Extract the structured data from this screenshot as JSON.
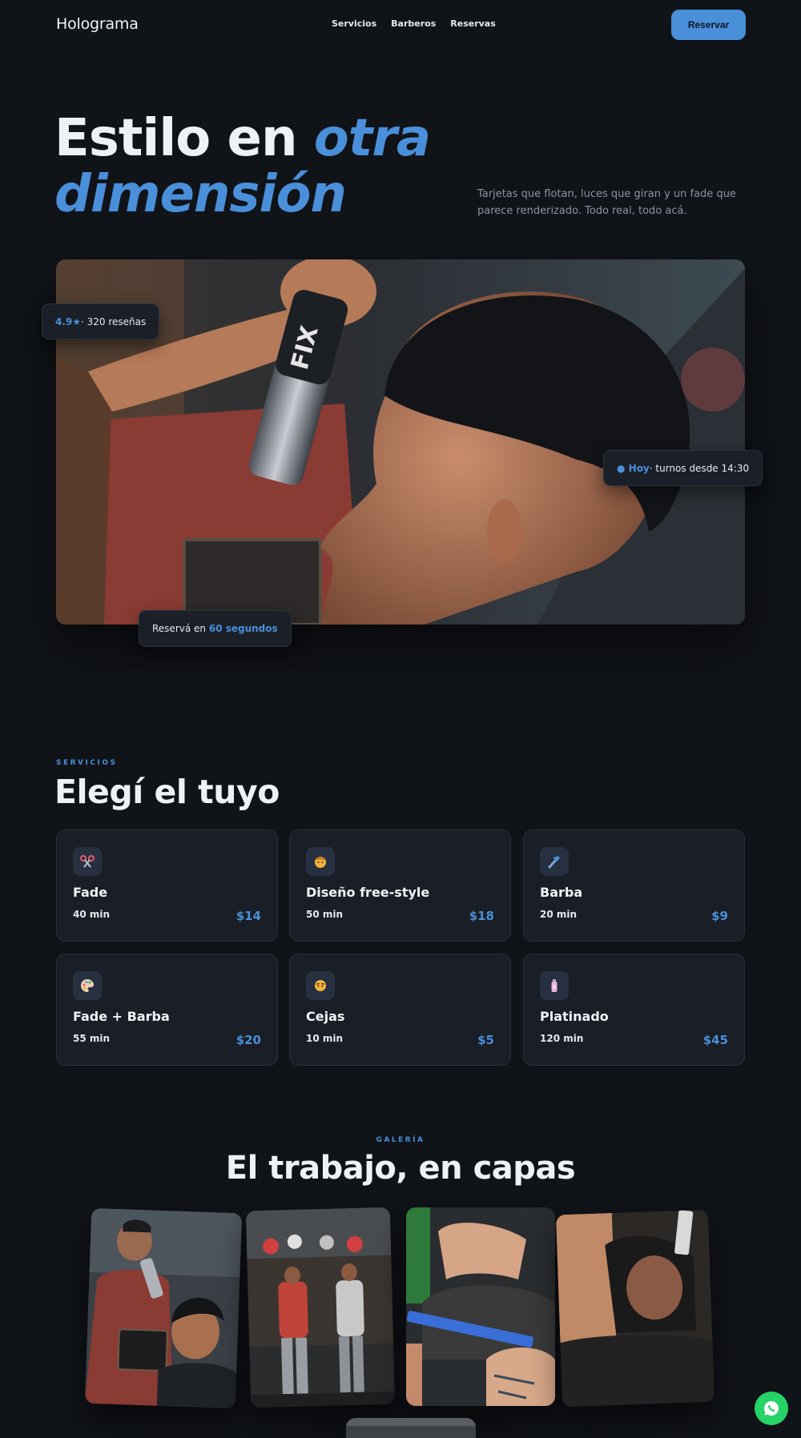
{
  "nav": {
    "brand": "Holograma",
    "links": [
      "Servicios",
      "Barberos",
      "Reservas"
    ],
    "cta": "Reservar"
  },
  "hero": {
    "title_line1": "Estilo en ",
    "title_em1": "otra",
    "title_em2": "dimensión",
    "subtitle": "Tarjetas que flotan, luces que giran y un fade que parece renderizado. Todo real, todo acá.",
    "chips": {
      "rating_value": "4.9★",
      "rating_text": " · 320 reseñas",
      "today_dot": "● Hoy",
      "today_text": " · turnos desde 14:30",
      "book_text": "Reservá en ",
      "book_em": "60 segundos"
    }
  },
  "services": {
    "eyebrow": "SERVICIOS",
    "title": "Elegí el tuyo",
    "items": [
      {
        "icon": "scissors-icon",
        "name": "Fade",
        "duration": "40 min",
        "price": "$14"
      },
      {
        "icon": "man-face-icon",
        "name": "Diseño free-style",
        "duration": "50 min",
        "price": "$18"
      },
      {
        "icon": "razor-icon",
        "name": "Barba",
        "duration": "20 min",
        "price": "$9"
      },
      {
        "icon": "palette-icon",
        "name": "Fade + Barba",
        "duration": "55 min",
        "price": "$20"
      },
      {
        "icon": "face-icon",
        "name": "Cejas",
        "duration": "10 min",
        "price": "$5"
      },
      {
        "icon": "bottle-icon",
        "name": "Platinado",
        "duration": "120 min",
        "price": "$45"
      }
    ]
  },
  "gallery": {
    "eyebrow": "GALERÍA",
    "title": "El trabajo, en capas"
  },
  "colors": {
    "background": "#101318",
    "accent": "#4a8fd9",
    "card": "#1a1e26",
    "whatsapp": "#25d366"
  }
}
